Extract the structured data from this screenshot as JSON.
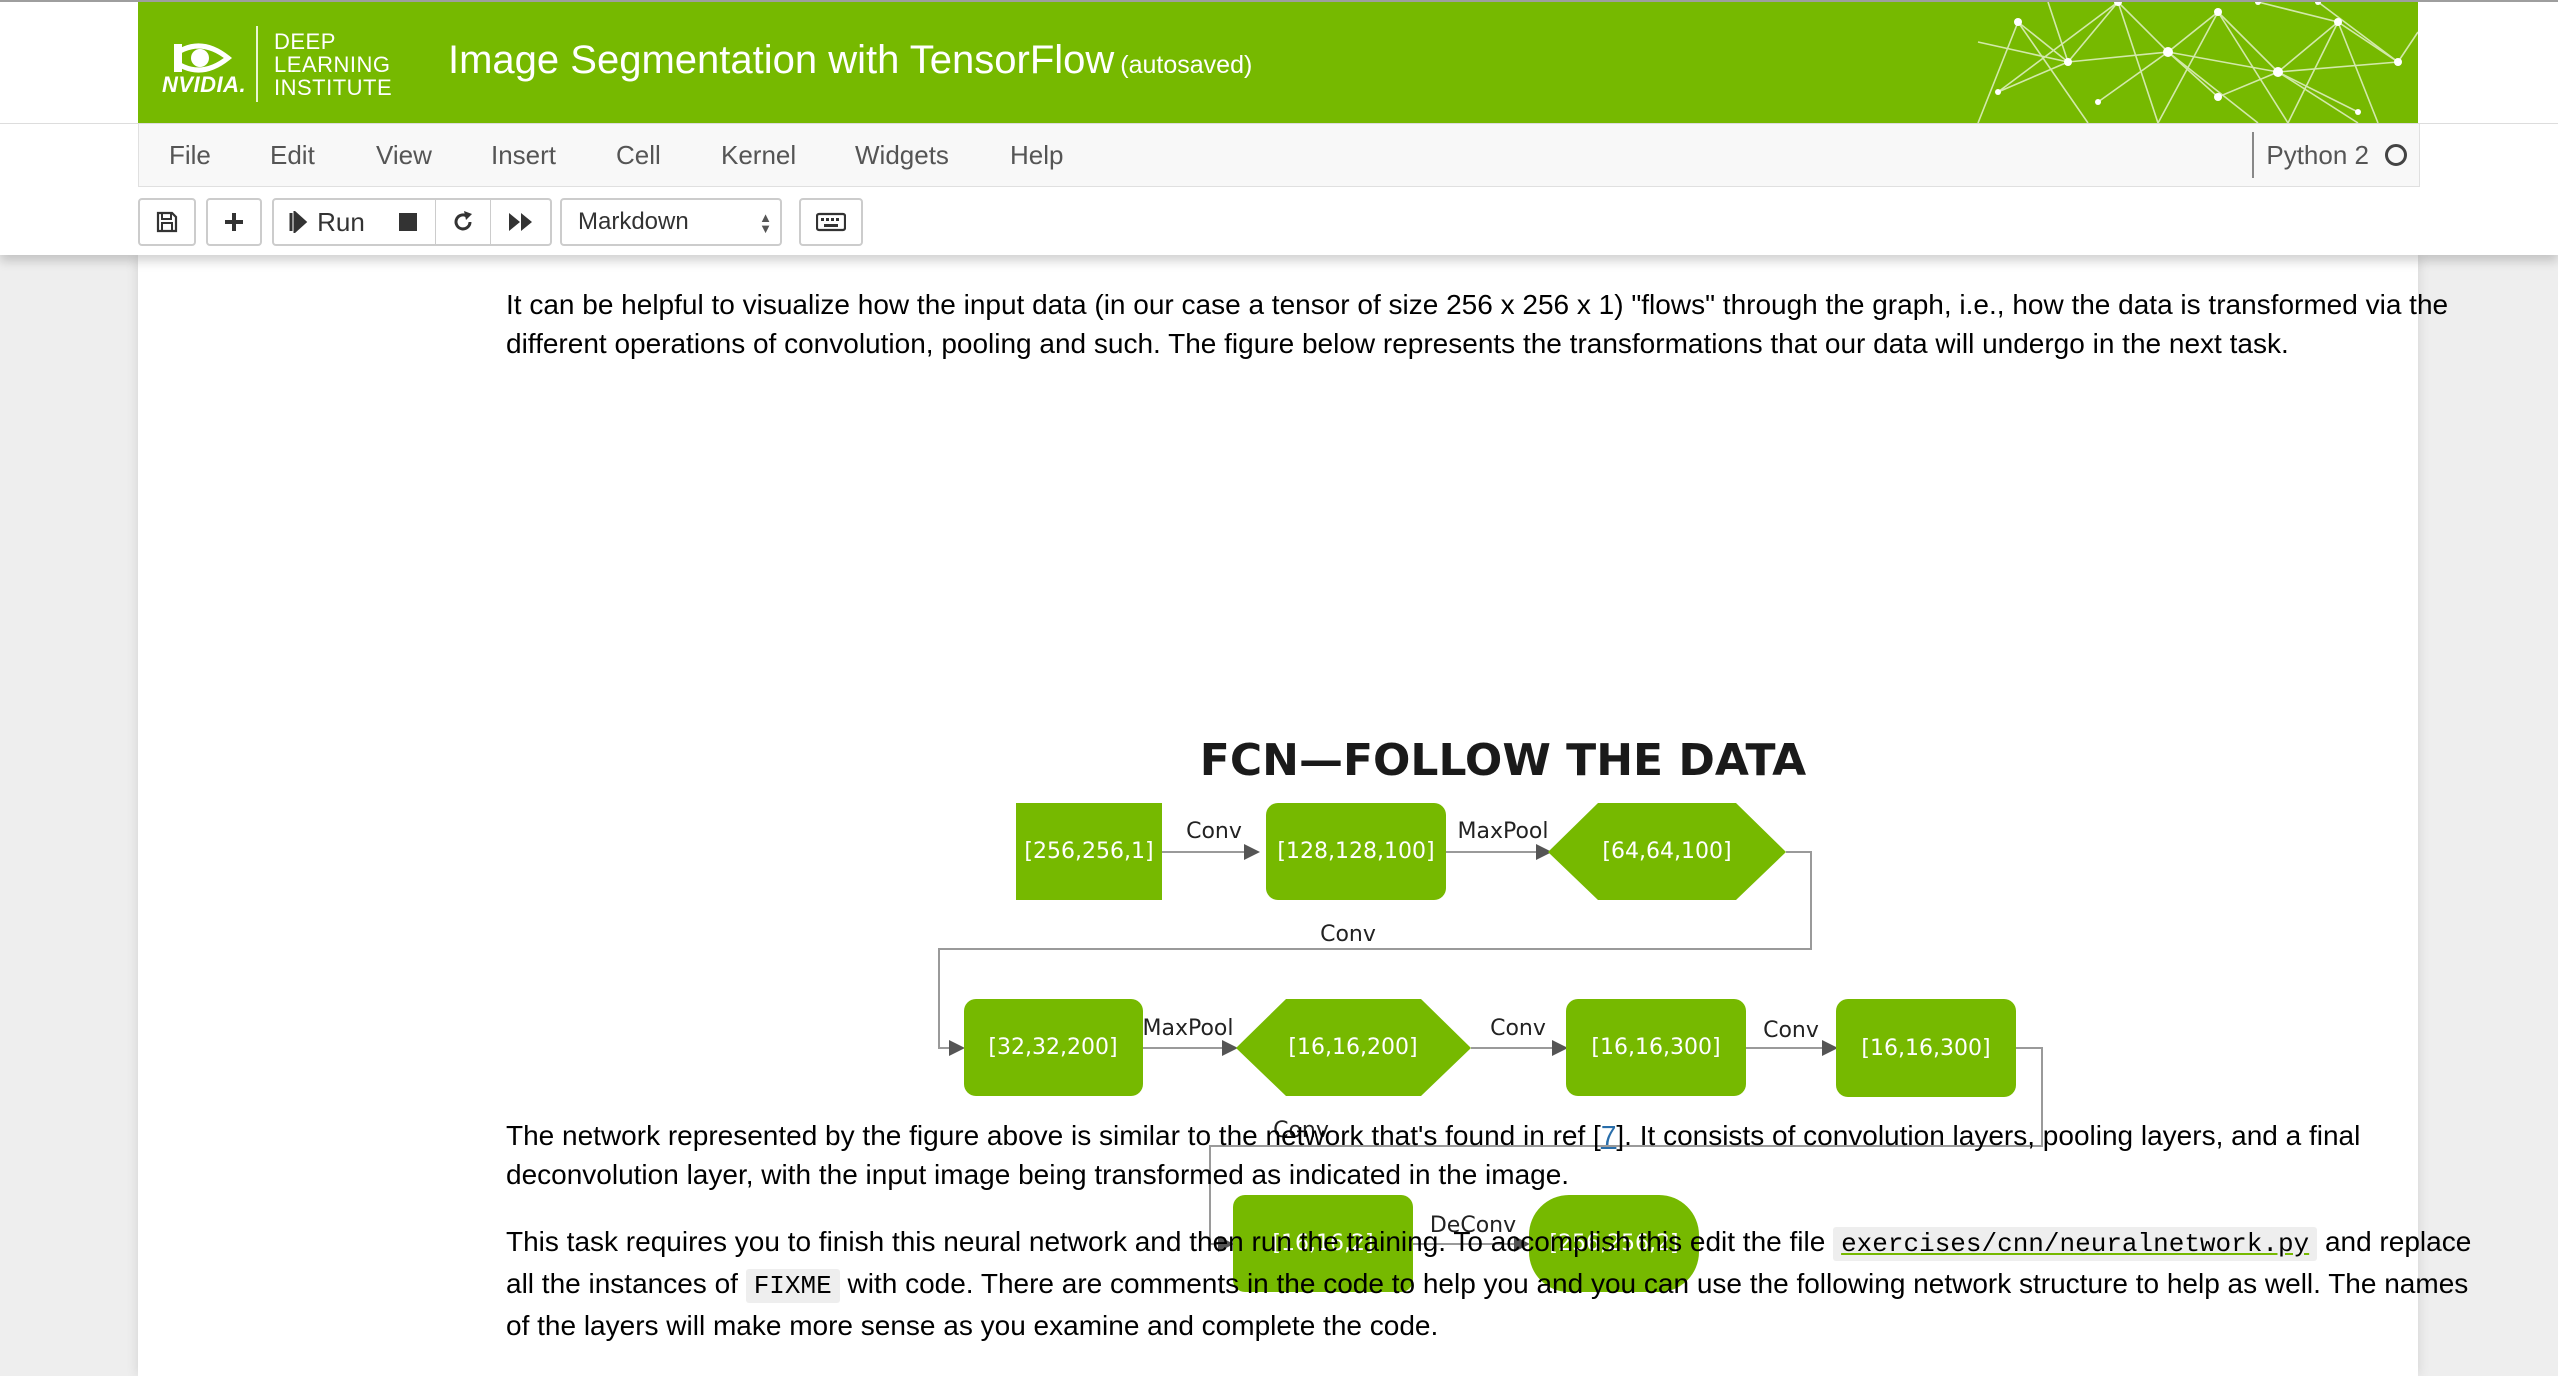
{
  "header": {
    "brand_word": "NVIDIA.",
    "dli_lines": [
      "DEEP",
      "LEARNING",
      "INSTITUTE"
    ],
    "title": "Image Segmentation with TensorFlow",
    "autosave": "(autosaved)",
    "brand_color": "#76b900"
  },
  "menubar": {
    "items": [
      "File",
      "Edit",
      "View",
      "Insert",
      "Cell",
      "Kernel",
      "Widgets",
      "Help"
    ],
    "kernel_name": "Python 2"
  },
  "toolbar": {
    "run_label": "Run",
    "cell_type": "Markdown",
    "icons": [
      "save-icon",
      "plus-icon",
      "run-icon",
      "stop-icon",
      "restart-icon",
      "fast-forward-icon",
      "keyboard-icon"
    ]
  },
  "content": {
    "intro": "It can be helpful to visualize how the input data (in our case a tensor of size 256 x 256 x 1) \"flows\" through the graph, i.e., how the data is transformed via the different operations of convolution, pooling and such. The figure below represents the transformations that our data will undergo in the next task.",
    "para2_before": "The network represented by the figure above is similar to the network that's found in ref [",
    "para2_ref": "7",
    "para2_after": "]. It consists of convolution layers, pooling layers, and a final deconvolution layer, with the input image being transformed as indicated in the image.",
    "para3_a": "This task requires you to finish this neural network and then run the training. To accomplish this edit the file",
    "para3_file": "exercises/cnn/neuralnetwork.py",
    "para3_b": "and replace all the instances of",
    "para3_code": "FIXME",
    "para3_c": "with code. There are comments in the code to help you and you can use the following network structure to help as well. The names of the layers will make more sense as you examine and complete the code."
  },
  "figure": {
    "title": "FCN—FOLLOW THE DATA",
    "nodes": {
      "n1": "[256,256,1]",
      "n2": "[128,128,100]",
      "n3": "[64,64,100]",
      "n4": "[32,32,200]",
      "n5": "[16,16,200]",
      "n6": "[16,16,300]",
      "n7": "[16,16,300]",
      "n8": "[16,16,2]",
      "n9": "[256,256,2]"
    },
    "edges": {
      "e1": "Conv",
      "e2": "MaxPool",
      "e3": "Conv",
      "e4": "MaxPool",
      "e5": "Conv",
      "e6": "Conv",
      "e7": "Conv",
      "e8": "DeConv"
    },
    "node_color": "#76b900"
  }
}
